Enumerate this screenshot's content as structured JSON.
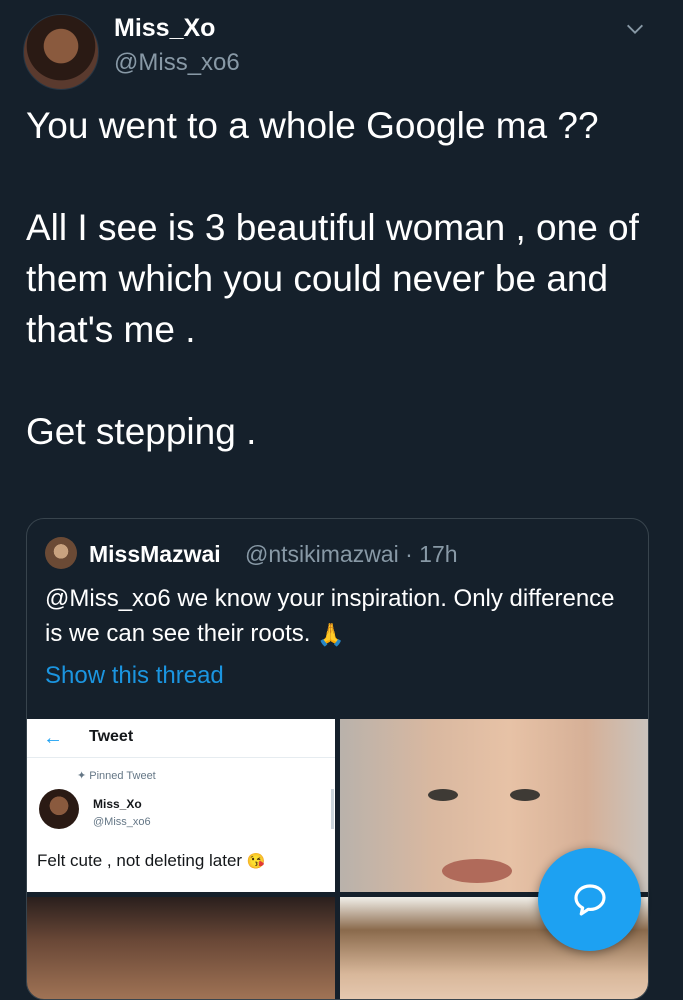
{
  "tweet": {
    "display_name": "Miss_Xo",
    "handle": "@Miss_xo6",
    "text": "You went to a whole Google ma ??\n\nAll I see is 3 beautiful woman , one of them which you could never be and that's me .\n\nGet stepping ."
  },
  "quoted": {
    "display_name": "MissMazwai",
    "meta": "@ntsikimazwai · 17h",
    "text": "@Miss_xo6 we know your inspiration. Only difference is we can see their roots.",
    "emoji": "🙏",
    "show_thread_label": "Show this thread",
    "screenshot": {
      "title": "Tweet",
      "pinned_label": "Pinned Tweet",
      "name": "Miss_Xo",
      "handle": "@Miss_xo6",
      "text": "Felt cute , not deleting later",
      "emoji": "😘"
    }
  },
  "icons": {
    "chevron": "chevron-down-icon",
    "compose": "compose-reply-icon",
    "back": "back-arrow-icon"
  },
  "colors": {
    "background": "#15202b",
    "accent": "#1da1f2",
    "link": "#1b95e0",
    "muted": "#8899a6"
  }
}
